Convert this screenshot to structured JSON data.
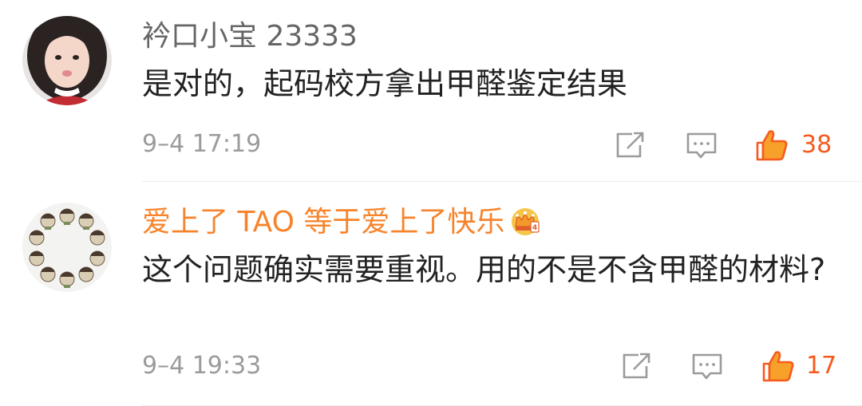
{
  "comments": [
    {
      "username": "衿口小宝 23333",
      "text": "是对的，起码校方拿出甲醛鉴定结果",
      "time": "9–4 17:19",
      "like_count": "38"
    },
    {
      "username": "爱上了 TAO 等于爱上了快乐",
      "text": "这个问题确实需要重视。用的不是不含甲醛的材料?",
      "time": "9–4 19:33",
      "like_count": "17"
    }
  ],
  "colors": {
    "username_vip": "#f7842c",
    "username_normal": "#666666",
    "like_accent": "#f55a1e",
    "icon_gray": "#9b9b9b"
  },
  "icons": {
    "share": "share-icon",
    "comment": "comment-icon",
    "like": "thumbs-up-icon",
    "badge": "crown-badge-icon"
  }
}
